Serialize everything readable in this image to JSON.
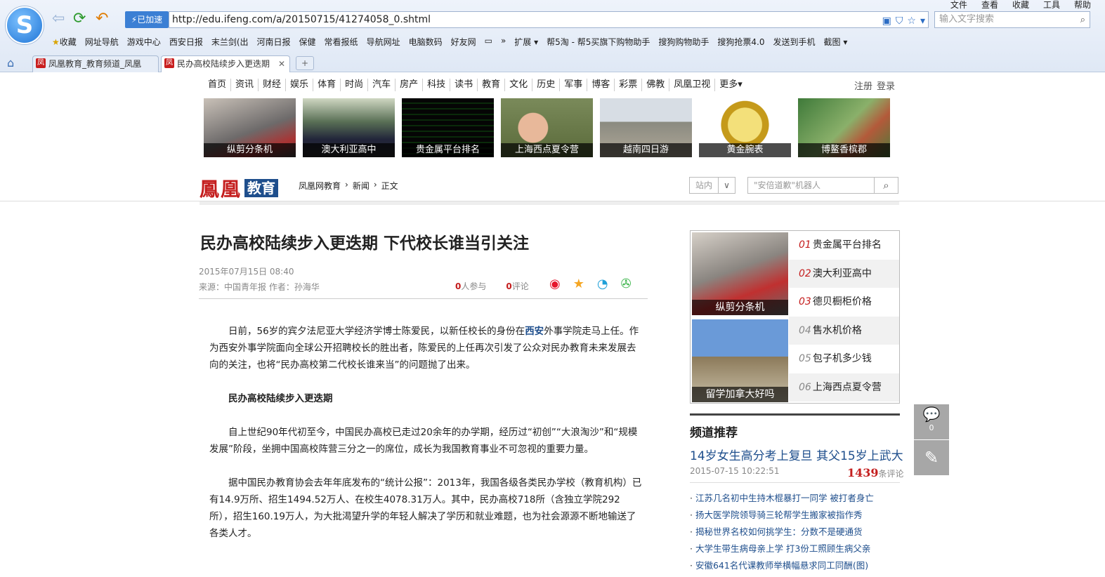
{
  "browser": {
    "menu": [
      "文件",
      "查看",
      "收藏",
      "工具",
      "帮助"
    ],
    "speed_label": "已加速",
    "url": "http://edu.ifeng.com/a/20150715/41274058_0.shtml",
    "search_placeholder": "输入文字搜索",
    "bookmarks": [
      "收藏",
      "网址导航",
      "游戏中心",
      "西安日报",
      "末兰剑(出",
      "河南日报",
      "保健",
      "常看报纸",
      "导航网址",
      "电脑数码",
      "好友网",
      "",
      "»",
      "扩展",
      "帮5淘 - 帮5买旗下购物助手",
      "搜狗购物助手",
      "搜狗抢票4.0",
      "发送到手机",
      "截图"
    ],
    "tabs": [
      {
        "label": "凤凰教育_教育频道_凤凰"
      },
      {
        "label": "民办高校陆续步入更迭期"
      }
    ],
    "newtab": "+"
  },
  "topnav": [
    "首页",
    "资讯",
    "财经",
    "娱乐",
    "体育",
    "时尚",
    "汽车",
    "房产",
    "科技",
    "读书",
    "教育",
    "文化",
    "历史",
    "军事",
    "博客",
    "彩票",
    "佛教",
    "凤凰卫视",
    "更多▾"
  ],
  "auth": {
    "register": "注册",
    "login": "登录"
  },
  "ads": [
    "纵剪分条机",
    "澳大利亚高中",
    "贵金属平台排名",
    "上海西点夏令营",
    "越南四日游",
    "黄金腕表",
    "博鳌香槟郡"
  ],
  "brand": {
    "name": "鳳凰",
    "channel": "教育"
  },
  "breadcrumb": [
    "凤凰网教育",
    "新闻",
    "正文"
  ],
  "site_select": "站内",
  "page_search_placeholder": "\"安倍道歉\"机器人",
  "article": {
    "title": "民办高校陆续步入更迭期 下代校长谁当引关注",
    "datetime": "2015年07月15日 08:40",
    "source": "来源：中国青年报  作者：孙海华",
    "participants": "0",
    "participants_label": "人参与",
    "comments": "0",
    "comments_label": "评论",
    "para1_a": "日前，56岁的宾夕法尼亚大学经济学博士陈爱民，以新任校长的身份在",
    "para1_link": "西安",
    "para1_b": "外事学院走马上任。作为西安外事学院面向全球公开招聘校长的胜出者，陈爱民的上任再次引发了公众对民办教育未来发展去向的关注，也将“民办高校第二代校长谁来当”的问题抛了出来。",
    "heading": "民办高校陆续步入更迭期",
    "para2": "自上世纪90年代初至今，中国民办高校已走过20余年的办学期，经历过“初创”“大浪淘沙”和“规模发展”阶段，坐拥中国高校阵营三分之一的席位，成长为我国教育事业不可忽视的重要力量。",
    "para3": "据中国民办教育协会去年年底发布的“统计公报”：2013年，我国各级各类民办学校（教育机构）已有14.9万所、招生1494.52万人、在校生4078.31万人。其中，民办高校718所（含独立学院292所），招生160.19万人，为大批渴望升学的年轻人解决了学历和就业难题，也为社会源源不断地输送了各类人才。"
  },
  "rail": {
    "img1": "纵剪分条机",
    "img2": "留学加拿大好吗",
    "ranks": [
      {
        "n": "01",
        "t": "贵金属平台排名"
      },
      {
        "n": "02",
        "t": "澳大利亚高中"
      },
      {
        "n": "03",
        "t": "德贝橱柜价格"
      },
      {
        "n": "04",
        "t": "售水机价格"
      },
      {
        "n": "05",
        "t": "包子机多少钱"
      },
      {
        "n": "06",
        "t": "上海西点夏令营"
      }
    ],
    "rec_heading": "频道推荐",
    "rec_title": "14岁女生高分考上复旦 其父15岁上武大",
    "rec_date": "2015-07-15 10:22:51",
    "rec_count": "1439",
    "rec_count_label": "条评论",
    "list": [
      "江苏几名初中生持木棍暴打一同学 被打者身亡",
      "扬大医学院领导骑三轮帮学生搬家被指作秀",
      "揭秘世界名校如何挑学生：分数不是硬通货",
      "大学生带生病母亲上学 打3份工照顾生病父亲",
      "安徽641名代课教师举横幅悬求同工同酬(图)"
    ]
  },
  "side": {
    "comment_count": "0"
  }
}
